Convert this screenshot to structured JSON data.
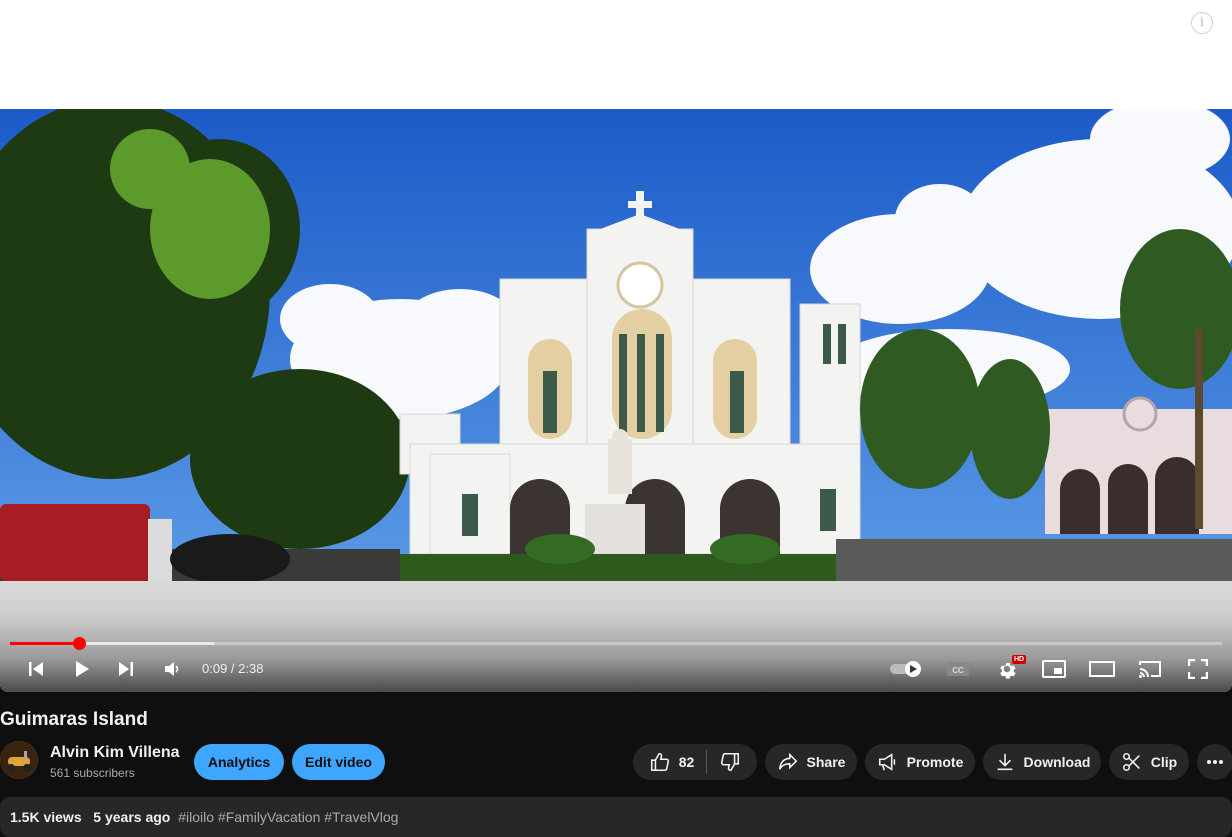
{
  "player": {
    "current_time": "0:09",
    "duration": "2:38",
    "progress_fraction": 0.057,
    "buffer_fraction": 0.168,
    "captions_label": "CC",
    "quality_badge": "HD"
  },
  "video": {
    "title": "Guimaras Island",
    "views": "1.5K views",
    "age": "5 years ago",
    "hashtags": "#iloilo #FamilyVacation #TravelVlog"
  },
  "channel": {
    "name": "Alvin Kim Villena",
    "subscribers": "561 subscribers"
  },
  "actions": {
    "analytics": "Analytics",
    "edit_video": "Edit video",
    "like_count": "82",
    "share": "Share",
    "promote": "Promote",
    "download": "Download",
    "clip": "Clip"
  },
  "colors": {
    "accent": "#ff0000",
    "primary_button": "#3ea6ff",
    "background": "#0f0f0f"
  }
}
